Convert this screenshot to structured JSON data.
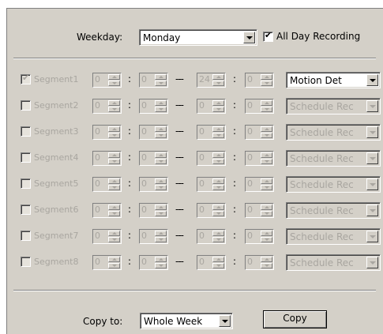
{
  "weekday": {
    "label": "Weekday:",
    "selected": "Monday"
  },
  "all_day": {
    "label": "All Day Recording",
    "checked": true
  },
  "segments": [
    {
      "label": "Segment1",
      "checked": true,
      "start_h": "0",
      "start_m": "0",
      "end_h": "24",
      "end_m": "0",
      "mode": "Motion Det",
      "enabled_mode": true
    },
    {
      "label": "Segment2",
      "checked": false,
      "start_h": "0",
      "start_m": "0",
      "end_h": "0",
      "end_m": "0",
      "mode": "Schedule Rec",
      "enabled_mode": false
    },
    {
      "label": "Segment3",
      "checked": false,
      "start_h": "0",
      "start_m": "0",
      "end_h": "0",
      "end_m": "0",
      "mode": "Schedule Rec",
      "enabled_mode": false
    },
    {
      "label": "Segment4",
      "checked": false,
      "start_h": "0",
      "start_m": "0",
      "end_h": "0",
      "end_m": "0",
      "mode": "Schedule Rec",
      "enabled_mode": false
    },
    {
      "label": "Segment5",
      "checked": false,
      "start_h": "0",
      "start_m": "0",
      "end_h": "0",
      "end_m": "0",
      "mode": "Schedule Rec",
      "enabled_mode": false
    },
    {
      "label": "Segment6",
      "checked": false,
      "start_h": "0",
      "start_m": "0",
      "end_h": "0",
      "end_m": "0",
      "mode": "Schedule Rec",
      "enabled_mode": false
    },
    {
      "label": "Segment7",
      "checked": false,
      "start_h": "0",
      "start_m": "0",
      "end_h": "0",
      "end_m": "0",
      "mode": "Schedule Rec",
      "enabled_mode": false
    },
    {
      "label": "Segment8",
      "checked": false,
      "start_h": "0",
      "start_m": "0",
      "end_h": "0",
      "end_m": "0",
      "mode": "Schedule Rec",
      "enabled_mode": false
    }
  ],
  "separators": {
    "colon": ":",
    "dash": "---"
  },
  "copy": {
    "label": "Copy to:",
    "selected": "Whole Week",
    "button": "Copy"
  },
  "checkmark": "✔",
  "colors": {
    "panel": "#d4d0c8",
    "disabled_text": "#a9a6a0"
  }
}
